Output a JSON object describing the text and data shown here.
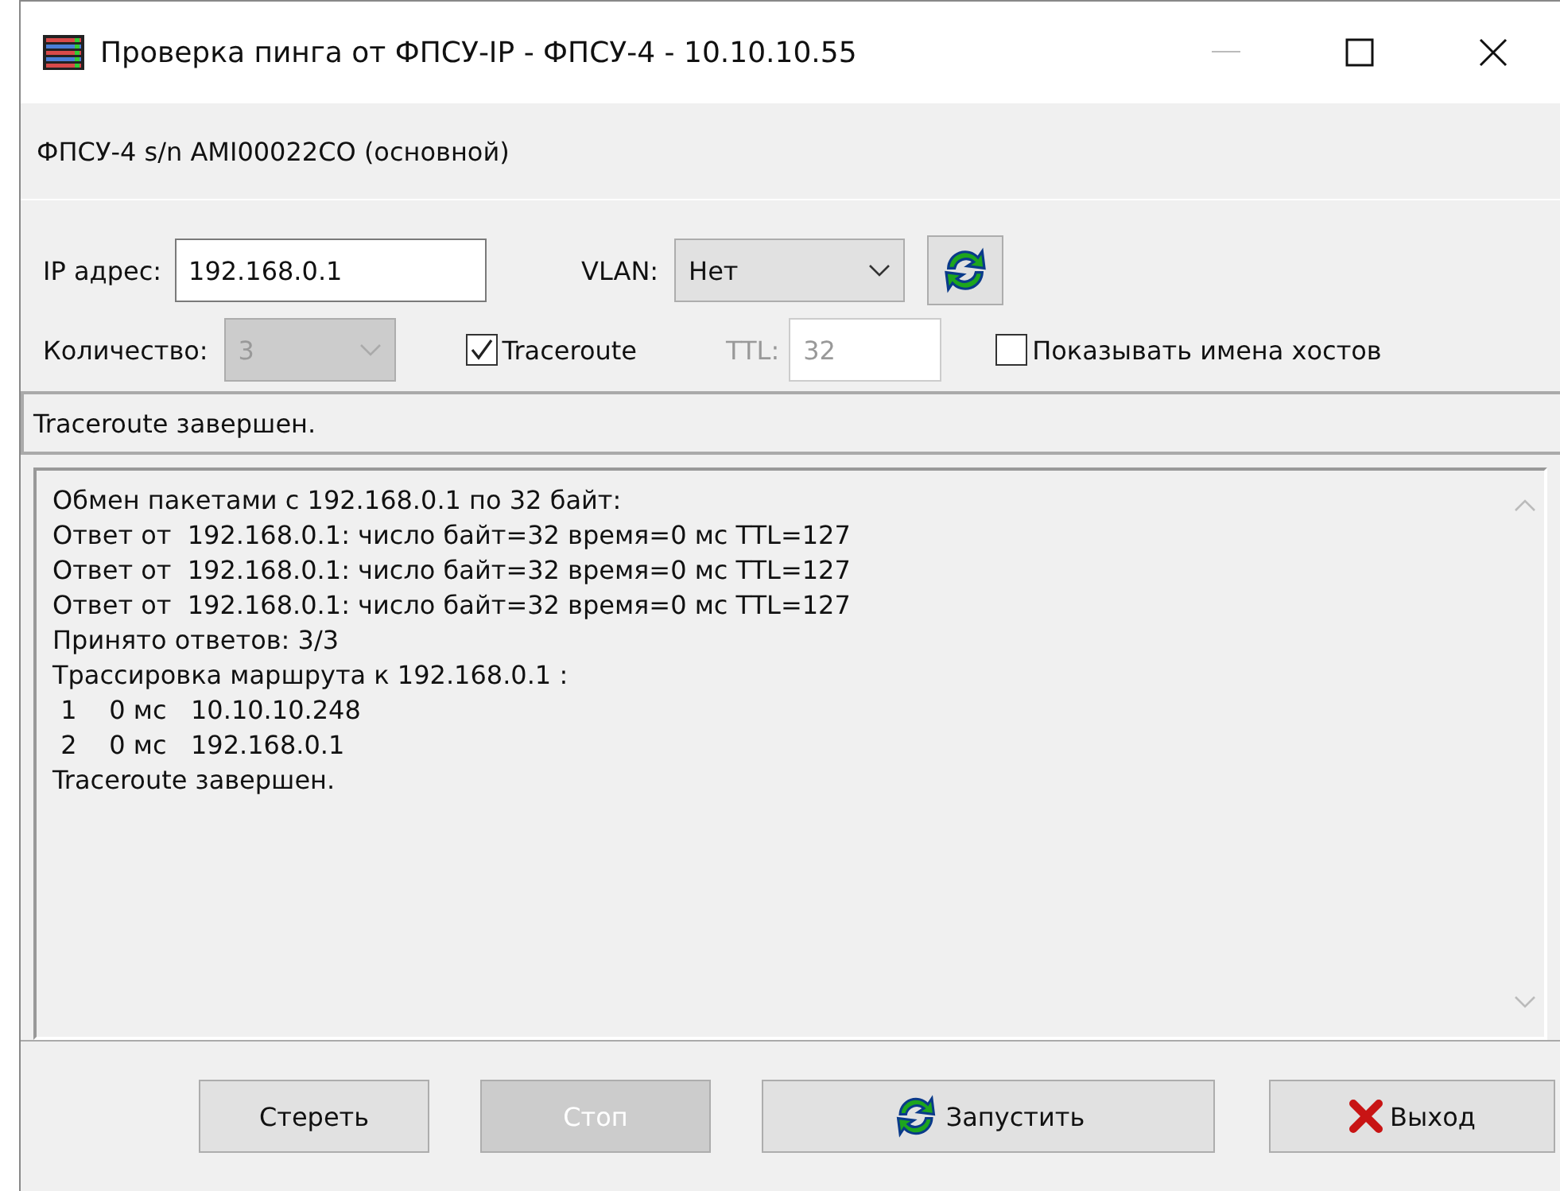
{
  "window": {
    "title": "Проверка пинга от ФПСУ-IP - ФПСУ-4 - 10.10.10.55"
  },
  "device": "ФПСУ-4 s/n AMI00022CO (основной)",
  "ip": {
    "label": "IP адрес:",
    "value": "192.168.0.1"
  },
  "vlan": {
    "label": "VLAN:",
    "value": "Нет"
  },
  "count": {
    "label": "Количество:",
    "value": "3",
    "disabled": true
  },
  "traceroute": {
    "label": "Traceroute",
    "checked": true
  },
  "ttl": {
    "label": "TTL:",
    "value": "32",
    "disabled": true
  },
  "hostnames": {
    "label": "Показывать имена хостов",
    "checked": false
  },
  "status": "Traceroute завершен.",
  "log": [
    "Обмен пакетами с 192.168.0.1 по 32 байт:",
    "Ответ от  192.168.0.1: число байт=32 время=0 мс TTL=127",
    "Ответ от  192.168.0.1: число байт=32 время=0 мс TTL=127",
    "Ответ от  192.168.0.1: число байт=32 время=0 мс TTL=127",
    "Принято ответов: 3/3",
    "Трассировка маршрута к 192.168.0.1 :",
    " 1    0 мс   10.10.10.248",
    " 2    0 мс   192.168.0.1",
    "Traceroute завершен."
  ],
  "buttons": [
    {
      "label": "Стереть",
      "kind": "plain",
      "disabled": false
    },
    {
      "label": "Стоп",
      "kind": "plain",
      "disabled": true
    },
    {
      "label": "Запустить",
      "kind": "run",
      "disabled": false
    },
    {
      "label": "Выход",
      "kind": "exit",
      "disabled": false
    }
  ]
}
